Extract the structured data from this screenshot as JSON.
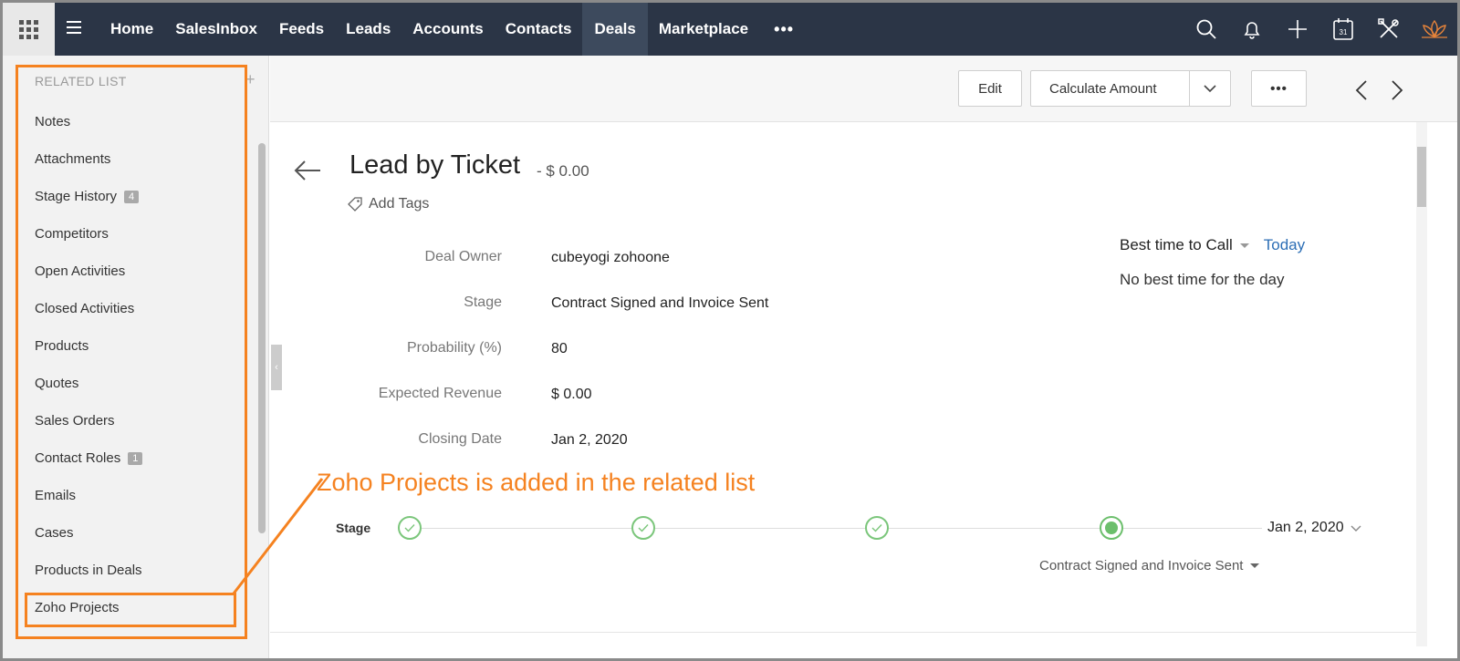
{
  "topnav": {
    "items": [
      {
        "label": "Home",
        "active": false
      },
      {
        "label": "SalesInbox",
        "active": false
      },
      {
        "label": "Feeds",
        "active": false
      },
      {
        "label": "Leads",
        "active": false
      },
      {
        "label": "Accounts",
        "active": false
      },
      {
        "label": "Contacts",
        "active": false
      },
      {
        "label": "Deals",
        "active": true
      },
      {
        "label": "Marketplace",
        "active": false
      }
    ],
    "more": "•••",
    "icons": [
      "search-icon",
      "bell-icon",
      "plus-icon",
      "calendar-icon",
      "tools-icon",
      "lotus-logo-icon"
    ],
    "calendar_day": "31"
  },
  "sidebar": {
    "header": "RELATED LIST",
    "items": [
      {
        "label": "Notes",
        "badge": ""
      },
      {
        "label": "Attachments",
        "badge": ""
      },
      {
        "label": "Stage History",
        "badge": "4"
      },
      {
        "label": "Competitors",
        "badge": ""
      },
      {
        "label": "Open Activities",
        "badge": ""
      },
      {
        "label": "Closed Activities",
        "badge": ""
      },
      {
        "label": "Products",
        "badge": ""
      },
      {
        "label": "Quotes",
        "badge": ""
      },
      {
        "label": "Sales Orders",
        "badge": ""
      },
      {
        "label": "Contact Roles",
        "badge": "1"
      },
      {
        "label": "Emails",
        "badge": ""
      },
      {
        "label": "Cases",
        "badge": ""
      },
      {
        "label": "Products in Deals",
        "badge": ""
      },
      {
        "label": "Zoho Projects",
        "badge": ""
      }
    ]
  },
  "actions": {
    "edit": "Edit",
    "calculate": "Calculate Amount",
    "more": "•••"
  },
  "record": {
    "title": "Lead by Ticket",
    "amount": "- $ 0.00",
    "add_tags": "Add Tags"
  },
  "fields": [
    {
      "label": "Deal Owner",
      "value": "cubeyogi zohoone"
    },
    {
      "label": "Stage",
      "value": "Contract Signed and Invoice Sent"
    },
    {
      "label": "Probability (%)",
      "value": "80"
    },
    {
      "label": "Expected Revenue",
      "value": "$ 0.00"
    },
    {
      "label": "Closing Date",
      "value": "Jan 2, 2020"
    }
  ],
  "best_time": {
    "label": "Best time to Call",
    "today": "Today",
    "message": "No best time for the day"
  },
  "stage_timeline": {
    "label": "Stage",
    "date": "Jan 2, 2020",
    "current_stage": "Contract Signed and Invoice Sent",
    "stages_completed": 3
  },
  "annotation": {
    "text": "Zoho Projects is added in the related list",
    "color": "#f58220"
  },
  "colors": {
    "topbar": "#2b3546",
    "accent_link": "#2c6eb5",
    "stage_green": "#6cbf6c"
  }
}
